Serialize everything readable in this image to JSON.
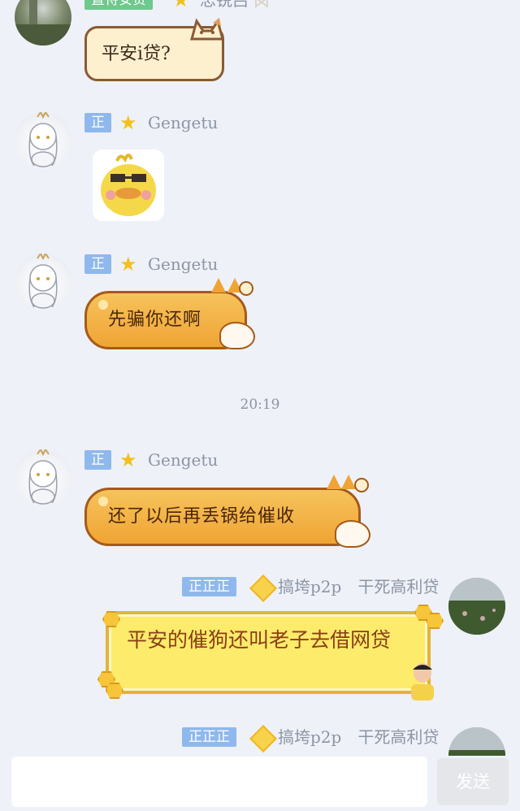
{
  "messages": [
    {
      "id": "m1",
      "sender": {
        "badge": "置待安贷",
        "name": "忠锐吕",
        "avatar": "photo-avatar"
      },
      "bubble_style": "cream-cat",
      "text": "平安i贷?"
    },
    {
      "id": "m2",
      "sender": {
        "badge": "正",
        "name": "Gengetu",
        "avatar": "anime-avatar"
      },
      "bubble_style": "sticker",
      "sticker": "duck-sticker"
    },
    {
      "id": "m3",
      "sender": {
        "badge": "正",
        "name": "Gengetu",
        "avatar": "anime-avatar"
      },
      "bubble_style": "corgi",
      "text": "先骗你还啊"
    },
    {
      "id": "m4",
      "sender": {
        "badge": "正",
        "name": "Gengetu",
        "avatar": "anime-avatar"
      },
      "bubble_style": "corgi",
      "text": "还了以后再丢锅给催收"
    },
    {
      "id": "m5",
      "sender": {
        "badge": "正正正",
        "name": "搞垮p2p　干死高利贷",
        "avatar": "field-photo-avatar"
      },
      "bubble_style": "honey-yellow",
      "text": "平安的催狗还叫老子去借网贷"
    },
    {
      "id": "m6",
      "sender": {
        "badge": "正正正",
        "name": "搞垮p2p　干死高利贷",
        "avatar": "field-photo-avatar"
      }
    }
  ],
  "timestamp": "20:19",
  "composer": {
    "send_label": "发送",
    "input_value": ""
  },
  "colors": {
    "background": "#eef1f8",
    "badge_blue": "#8fb8ec",
    "badge_green": "#6fc88c",
    "corgi_orange": "#f0a434",
    "honey_yellow": "#fdeb6b"
  }
}
